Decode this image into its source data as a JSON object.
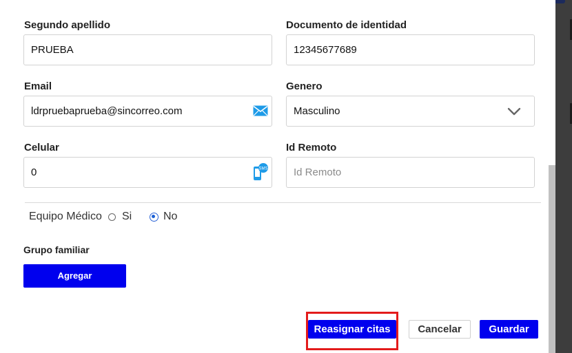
{
  "form": {
    "segundo_apellido": {
      "label": "Segundo apellido",
      "value": "PRUEBA"
    },
    "documento": {
      "label": "Documento de identidad",
      "value": "12345677689"
    },
    "email": {
      "label": "Email",
      "value": "ldrpruebaprueba@sincorreo.com",
      "icon": "envelope-icon"
    },
    "genero": {
      "label": "Genero",
      "value": "Masculino",
      "icon": "chevron-down-icon"
    },
    "celular": {
      "label": "Celular",
      "value": "0",
      "icon": "sms-phone-icon"
    },
    "id_remoto": {
      "label": "Id Remoto",
      "placeholder": "Id Remoto"
    },
    "equipo_medico": {
      "label": "Equipo Médico",
      "options": [
        "Si",
        "No"
      ],
      "selected": "No"
    },
    "grupo_familiar": {
      "label": "Grupo familiar",
      "button": "Agregar"
    }
  },
  "footer": {
    "reassign_label": "Reasignar citas",
    "cancel_label": "Cancelar",
    "save_label": "Guardar"
  },
  "colors": {
    "primary_button": "#0000ee",
    "highlight_border": "#e31b1b",
    "icon_blue": "#1e9be8"
  }
}
